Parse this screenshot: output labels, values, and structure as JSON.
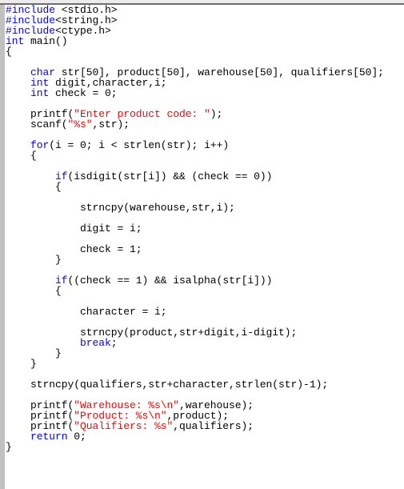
{
  "editor": {
    "language": "C",
    "colors": {
      "keyword": "#0000ff",
      "string": "#ff0000",
      "text": "#000000",
      "gutter": "#c0c0c0",
      "background": "#ffffff"
    },
    "lines": [
      [
        {
          "t": "pp",
          "v": "#include"
        },
        {
          "t": "plain",
          "v": " <stdio.h>"
        }
      ],
      [
        {
          "t": "pp",
          "v": "#include"
        },
        {
          "t": "plain",
          "v": "<string.h>"
        }
      ],
      [
        {
          "t": "pp",
          "v": "#include"
        },
        {
          "t": "plain",
          "v": "<ctype.h>"
        }
      ],
      [
        {
          "t": "kw",
          "v": "int"
        },
        {
          "t": "plain",
          "v": " main()"
        }
      ],
      [
        {
          "t": "plain",
          "v": "{"
        }
      ],
      [],
      [
        {
          "t": "plain",
          "v": "    "
        },
        {
          "t": "kw",
          "v": "char"
        },
        {
          "t": "plain",
          "v": " str[50], product[50], warehouse[50], qualifiers[50];"
        }
      ],
      [
        {
          "t": "plain",
          "v": "    "
        },
        {
          "t": "kw",
          "v": "int"
        },
        {
          "t": "plain",
          "v": " digit,character,i;"
        }
      ],
      [
        {
          "t": "plain",
          "v": "    "
        },
        {
          "t": "kw",
          "v": "int"
        },
        {
          "t": "plain",
          "v": " check = 0;"
        }
      ],
      [],
      [
        {
          "t": "plain",
          "v": "    printf("
        },
        {
          "t": "str",
          "v": "\"Enter product code: \""
        },
        {
          "t": "plain",
          "v": ");"
        }
      ],
      [
        {
          "t": "plain",
          "v": "    scanf("
        },
        {
          "t": "str",
          "v": "\"%s\""
        },
        {
          "t": "plain",
          "v": ",str);"
        }
      ],
      [],
      [
        {
          "t": "plain",
          "v": "    "
        },
        {
          "t": "kw",
          "v": "for"
        },
        {
          "t": "plain",
          "v": "(i = 0; i < strlen(str); i++)"
        }
      ],
      [
        {
          "t": "plain",
          "v": "    {"
        }
      ],
      [],
      [
        {
          "t": "plain",
          "v": "        "
        },
        {
          "t": "kw",
          "v": "if"
        },
        {
          "t": "plain",
          "v": "(isdigit(str[i]) && (check == 0))"
        }
      ],
      [
        {
          "t": "plain",
          "v": "        {"
        }
      ],
      [],
      [
        {
          "t": "plain",
          "v": "            strncpy(warehouse,str,i);"
        }
      ],
      [],
      [
        {
          "t": "plain",
          "v": "            digit = i;"
        }
      ],
      [],
      [
        {
          "t": "plain",
          "v": "            check = 1;"
        }
      ],
      [
        {
          "t": "plain",
          "v": "        }"
        }
      ],
      [],
      [
        {
          "t": "plain",
          "v": "        "
        },
        {
          "t": "kw",
          "v": "if"
        },
        {
          "t": "plain",
          "v": "((check == 1) && isalpha(str[i]))"
        }
      ],
      [
        {
          "t": "plain",
          "v": "        {"
        }
      ],
      [],
      [
        {
          "t": "plain",
          "v": "            character = i;"
        }
      ],
      [],
      [
        {
          "t": "plain",
          "v": "            strncpy(product,str+digit,i-digit);"
        }
      ],
      [
        {
          "t": "plain",
          "v": "            "
        },
        {
          "t": "kw",
          "v": "break"
        },
        {
          "t": "plain",
          "v": ";"
        }
      ],
      [
        {
          "t": "plain",
          "v": "        }"
        }
      ],
      [
        {
          "t": "plain",
          "v": "    }"
        }
      ],
      [],
      [
        {
          "t": "plain",
          "v": "    strncpy(qualifiers,str+character,strlen(str)-1);"
        }
      ],
      [],
      [
        {
          "t": "plain",
          "v": "    printf("
        },
        {
          "t": "str",
          "v": "\"Warehouse: %s\\n\""
        },
        {
          "t": "plain",
          "v": ",warehouse);"
        }
      ],
      [
        {
          "t": "plain",
          "v": "    printf("
        },
        {
          "t": "str",
          "v": "\"Product: %s\\n\""
        },
        {
          "t": "plain",
          "v": ",product);"
        }
      ],
      [
        {
          "t": "plain",
          "v": "    printf("
        },
        {
          "t": "str",
          "v": "\"Qualifiers: %s\""
        },
        {
          "t": "plain",
          "v": ",qualifiers);"
        }
      ],
      [
        {
          "t": "plain",
          "v": "    "
        },
        {
          "t": "kw",
          "v": "return"
        },
        {
          "t": "plain",
          "v": " 0;"
        }
      ],
      [
        {
          "t": "plain",
          "v": "}"
        }
      ]
    ]
  }
}
